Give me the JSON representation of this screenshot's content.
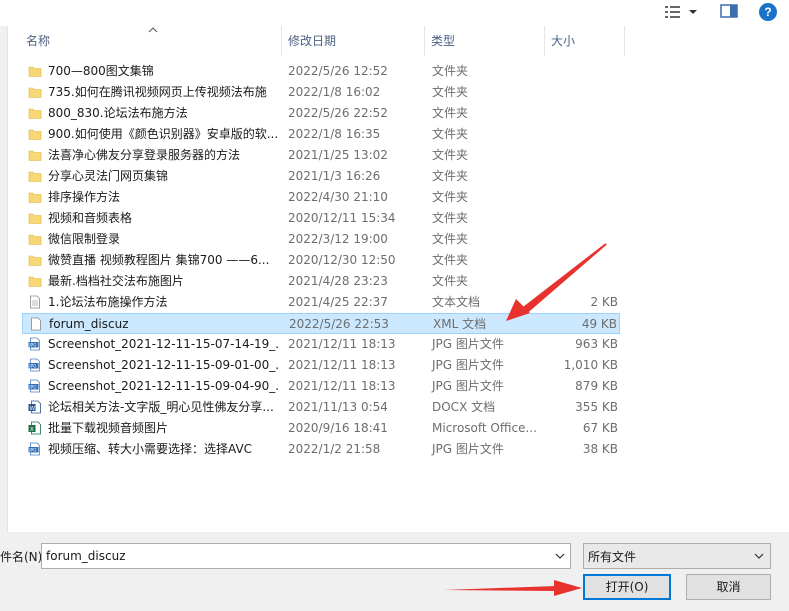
{
  "columns": {
    "name": "名称",
    "date": "修改日期",
    "type": "类型",
    "size": "大小"
  },
  "files": [
    {
      "name": "700—800图文集锦",
      "date": "2022/5/26 12:52",
      "type": "文件夹",
      "size": "",
      "icon": "folder-icon"
    },
    {
      "name": "735.如何在腾讯视频网页上传视频法布施",
      "date": "2022/1/8 16:02",
      "type": "文件夹",
      "size": "",
      "icon": "folder-icon"
    },
    {
      "name": "800_830.论坛法布施方法",
      "date": "2022/5/26 22:52",
      "type": "文件夹",
      "size": "",
      "icon": "folder-icon"
    },
    {
      "name": "900.如何使用《颜色识别器》安卓版的软...",
      "date": "2022/1/8 16:35",
      "type": "文件夹",
      "size": "",
      "icon": "folder-icon"
    },
    {
      "name": "法喜净心佛友分享登录服务器的方法",
      "date": "2021/1/25 13:02",
      "type": "文件夹",
      "size": "",
      "icon": "folder-icon"
    },
    {
      "name": "分享心灵法门网页集锦",
      "date": "2021/1/3 16:26",
      "type": "文件夹",
      "size": "",
      "icon": "folder-icon"
    },
    {
      "name": "排序操作方法",
      "date": "2022/4/30 21:10",
      "type": "文件夹",
      "size": "",
      "icon": "folder-icon"
    },
    {
      "name": "视频和音频表格",
      "date": "2020/12/11 15:34",
      "type": "文件夹",
      "size": "",
      "icon": "folder-icon"
    },
    {
      "name": "微信限制登录",
      "date": "2022/3/12 19:00",
      "type": "文件夹",
      "size": "",
      "icon": "folder-icon"
    },
    {
      "name": "微赞直播 视频教程图片 集锦700 ——6...",
      "date": "2020/12/30 12:50",
      "type": "文件夹",
      "size": "",
      "icon": "folder-icon"
    },
    {
      "name": "最新.档档社交法布施图片",
      "date": "2021/4/28 23:23",
      "type": "文件夹",
      "size": "",
      "icon": "folder-icon"
    },
    {
      "name": "1.论坛法布施操作方法",
      "date": "2021/4/25 22:37",
      "type": "文本文档",
      "size": "2 KB",
      "icon": "text-file-icon"
    },
    {
      "name": "forum_discuz",
      "date": "2022/5/26 22:53",
      "type": "XML 文档",
      "size": "49 KB",
      "icon": "blank-file-icon",
      "selected": true
    },
    {
      "name": "Screenshot_2021-12-11-15-07-14-19_...",
      "date": "2021/12/11 18:13",
      "type": "JPG 图片文件",
      "size": "963 KB",
      "icon": "jpg-file-icon"
    },
    {
      "name": "Screenshot_2021-12-11-15-09-01-00_...",
      "date": "2021/12/11 18:13",
      "type": "JPG 图片文件",
      "size": "1,010 KB",
      "icon": "jpg-file-icon"
    },
    {
      "name": "Screenshot_2021-12-11-15-09-04-90_...",
      "date": "2021/12/11 18:13",
      "type": "JPG 图片文件",
      "size": "879 KB",
      "icon": "jpg-file-icon"
    },
    {
      "name": "论坛相关方法-文字版_明心见性佛友分享...",
      "date": "2021/11/13 0:54",
      "type": "DOCX 文档",
      "size": "355 KB",
      "icon": "docx-file-icon"
    },
    {
      "name": "批量下载视频音频图片",
      "date": "2020/9/16 18:41",
      "type": "Microsoft Office...",
      "size": "67 KB",
      "icon": "excel-file-icon"
    },
    {
      "name": "视频压缩、转大小需要选择：选择AVC",
      "date": "2022/1/2 21:58",
      "type": "JPG 图片文件",
      "size": "38 KB",
      "icon": "jpg-file-icon"
    }
  ],
  "filename": {
    "label": "件名(N):",
    "value": "forum_discuz"
  },
  "filter": {
    "selected": "所有文件"
  },
  "buttons": {
    "open": "打开(O)",
    "cancel": "取消"
  },
  "colors": {
    "folder": "#f8d775",
    "selection": "#cce8ff",
    "arrow": "#e8322e",
    "accent": "#0078d7"
  }
}
